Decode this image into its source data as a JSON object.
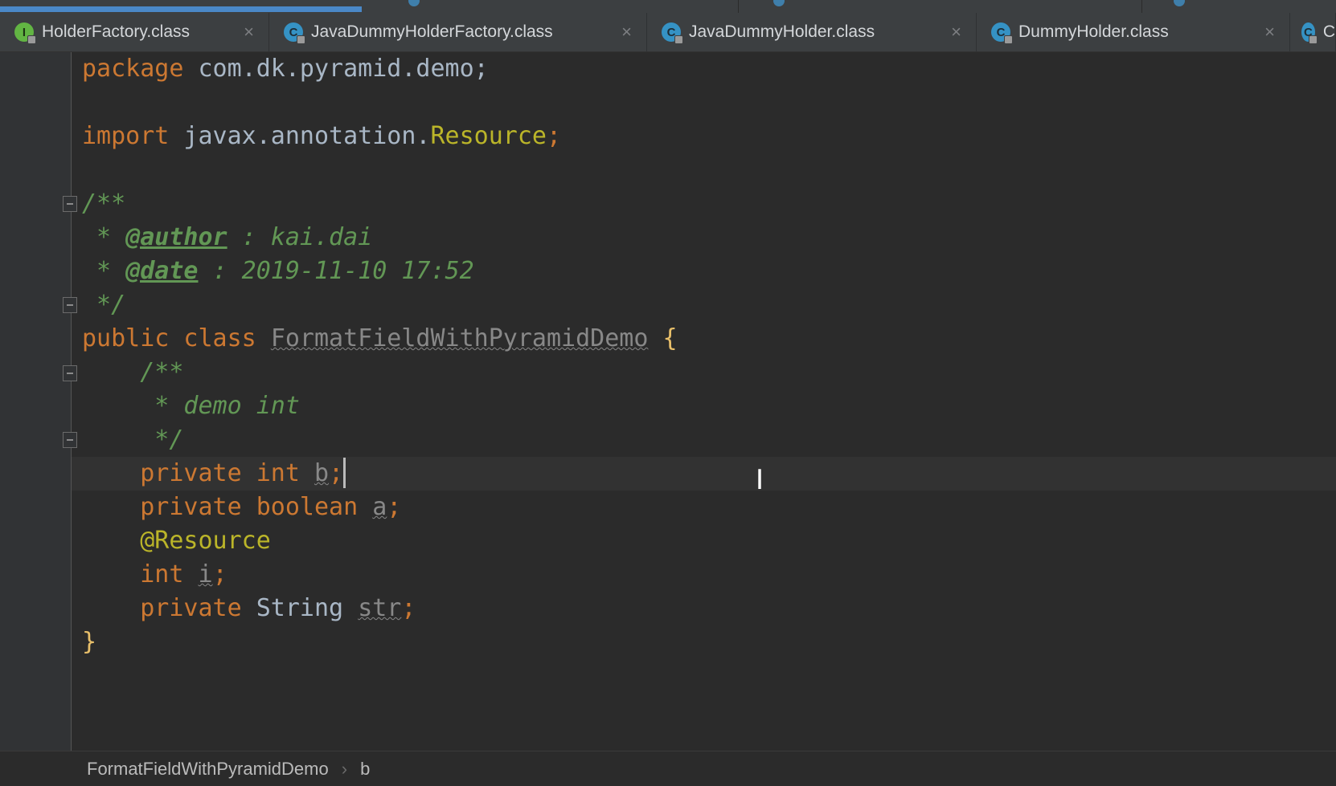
{
  "tabs": [
    {
      "label": "HolderFactory.class",
      "kind": "interface",
      "badge": "I"
    },
    {
      "label": "JavaDummyHolderFactory.class",
      "kind": "class",
      "badge": "C"
    },
    {
      "label": "JavaDummyHolder.class",
      "kind": "class",
      "badge": "C"
    },
    {
      "label": "DummyHolder.class",
      "kind": "class",
      "badge": "C"
    },
    {
      "label": "C",
      "kind": "class",
      "badge": "C"
    }
  ],
  "close_glyph": "×",
  "code": {
    "l1_kw": "package",
    "l1_rest": " com.dk.pyramid.demo;",
    "l3_kw": "import",
    "l3_pkg": " javax.annotation.",
    "l3_cls": "Resource",
    "l3_end": ";",
    "l5": "/**",
    "l6_star": " * ",
    "l6_tag": "@author",
    "l6_rest": " : kai.dai",
    "l7_star": " * ",
    "l7_tag": "@date",
    "l7_rest": " : 2019-11-10 17:52",
    "l8": " */",
    "l9_kw": "public class",
    "l9_name": "FormatFieldWithPyramidDemo",
    "l9_brace": "{",
    "l10": "    /**",
    "l11": "     * demo int",
    "l12": "     */",
    "l13_kw": "    private int ",
    "l13_var": "b",
    "l13_end": ";",
    "l14_kw": "    private boolean ",
    "l14_var": "a",
    "l14_end": ";",
    "l15": "    @Resource",
    "l16_kw": "    int ",
    "l16_var": "i",
    "l16_end": ";",
    "l17_kw": "    private ",
    "l17_type": "String ",
    "l17_var": "str",
    "l17_end": ";",
    "l18": "}"
  },
  "breadcrumb": {
    "class_name": "FormatFieldWithPyramidDemo",
    "separator": "›",
    "member": "b"
  },
  "mouse_cursor_glyph": "I",
  "colors": {
    "background": "#2b2b2b",
    "keyword": "#cc7832",
    "annotation": "#bbb529",
    "comment": "#629755",
    "text": "#a9b7c6",
    "tab_active_accent": "#4a88c7"
  }
}
